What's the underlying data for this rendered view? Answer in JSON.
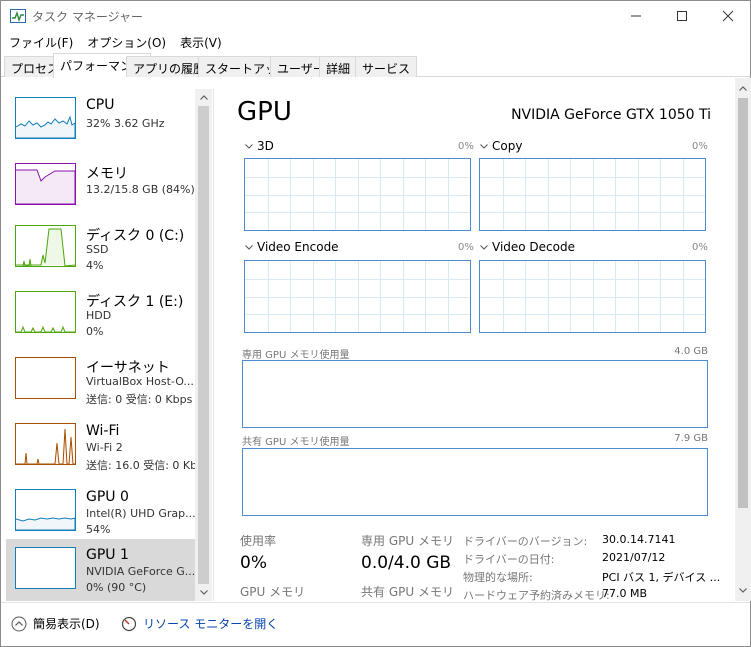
{
  "window": {
    "title": "タスク マネージャー",
    "icon": "task-manager-icon"
  },
  "menu": {
    "items": [
      "ファイル(F)",
      "オプション(O)",
      "表示(V)"
    ]
  },
  "tabs": [
    "プロセス",
    "パフォーマンス",
    "アプリの履歴",
    "スタートアップ",
    "ユーザー",
    "詳細",
    "サービス"
  ],
  "active_tab": "パフォーマンス",
  "resources": [
    {
      "name": "CPU",
      "line1": "32%  3.62 GHz",
      "line2": "",
      "color": "#117dbb",
      "fill": "#f1f6fa",
      "selected": false
    },
    {
      "name": "メモリ",
      "line1": "13.2/15.8 GB (84%)",
      "line2": "",
      "color": "#8b12ae",
      "fill": "#f4eaf6",
      "selected": false
    },
    {
      "name": "ディスク 0 (C:)",
      "line1": "SSD",
      "line2": "4%",
      "color": "#4da60c",
      "fill": "#eff7e6",
      "selected": false
    },
    {
      "name": "ディスク 1 (E:)",
      "line1": "HDD",
      "line2": "0%",
      "color": "#4da60c",
      "fill": "#eff7e6",
      "selected": false
    },
    {
      "name": "イーサネット",
      "line1": "VirtualBox Host-O...",
      "line2": "送信: 0 受信: 0 Kbps",
      "color": "#a74f01",
      "fill": "#fcf3eb",
      "selected": false
    },
    {
      "name": "Wi-Fi",
      "line1": "Wi-Fi 2",
      "line2": "送信: 16.0 受信: 0 Kb",
      "color": "#a74f01",
      "fill": "#fcf3eb",
      "selected": false
    },
    {
      "name": "GPU 0",
      "line1": "Intel(R) UHD Grap...",
      "line2": "54%",
      "color": "#117dbb",
      "fill": "#f1f6fa",
      "selected": false
    },
    {
      "name": "GPU 1",
      "line1": "NVIDIA GeForce G...",
      "line2": "0% (90 °C)",
      "color": "#117dbb",
      "fill": "#f1f6fa",
      "selected": true
    }
  ],
  "detail": {
    "title": "GPU",
    "model": "NVIDIA GeForce GTX 1050 Ti",
    "engines": [
      {
        "name": "3D",
        "pct": "0%"
      },
      {
        "name": "Copy",
        "pct": "0%"
      },
      {
        "name": "Video Encode",
        "pct": "0%"
      },
      {
        "name": "Video Decode",
        "pct": "0%"
      }
    ],
    "dedicated_label": "専用 GPU メモリ使用量",
    "dedicated_max": "4.0 GB",
    "shared_label": "共有 GPU メモリ使用量",
    "shared_max": "7.9 GB",
    "stats": {
      "usage_label": "使用率",
      "usage_value": "0%",
      "dedicated_label": "専用 GPU メモリ",
      "dedicated_value": "0.0/4.0 GB",
      "gpu_mem_label": "GPU メモリ",
      "shared_label": "共有 GPU メモリ"
    },
    "info": [
      {
        "key": "ドライバーのバージョン:",
        "value": "30.0.14.7141"
      },
      {
        "key": "ドライバーの日付:",
        "value": "2021/07/12"
      },
      {
        "key": "物理的な場所:",
        "value": "PCI バス 1, デバイス ..."
      },
      {
        "key": "ハードウェア予約済みメモリ:",
        "value": "77.0 MB"
      }
    ]
  },
  "footer": {
    "simple_view": "簡易表示(D)",
    "resource_monitor": "リソース モニターを開く"
  },
  "colors": {
    "graph_border": "#4a8bd1",
    "grid": "#d9eaf7",
    "selected_bg": "#d9d9d9",
    "link": "#0645ad"
  }
}
